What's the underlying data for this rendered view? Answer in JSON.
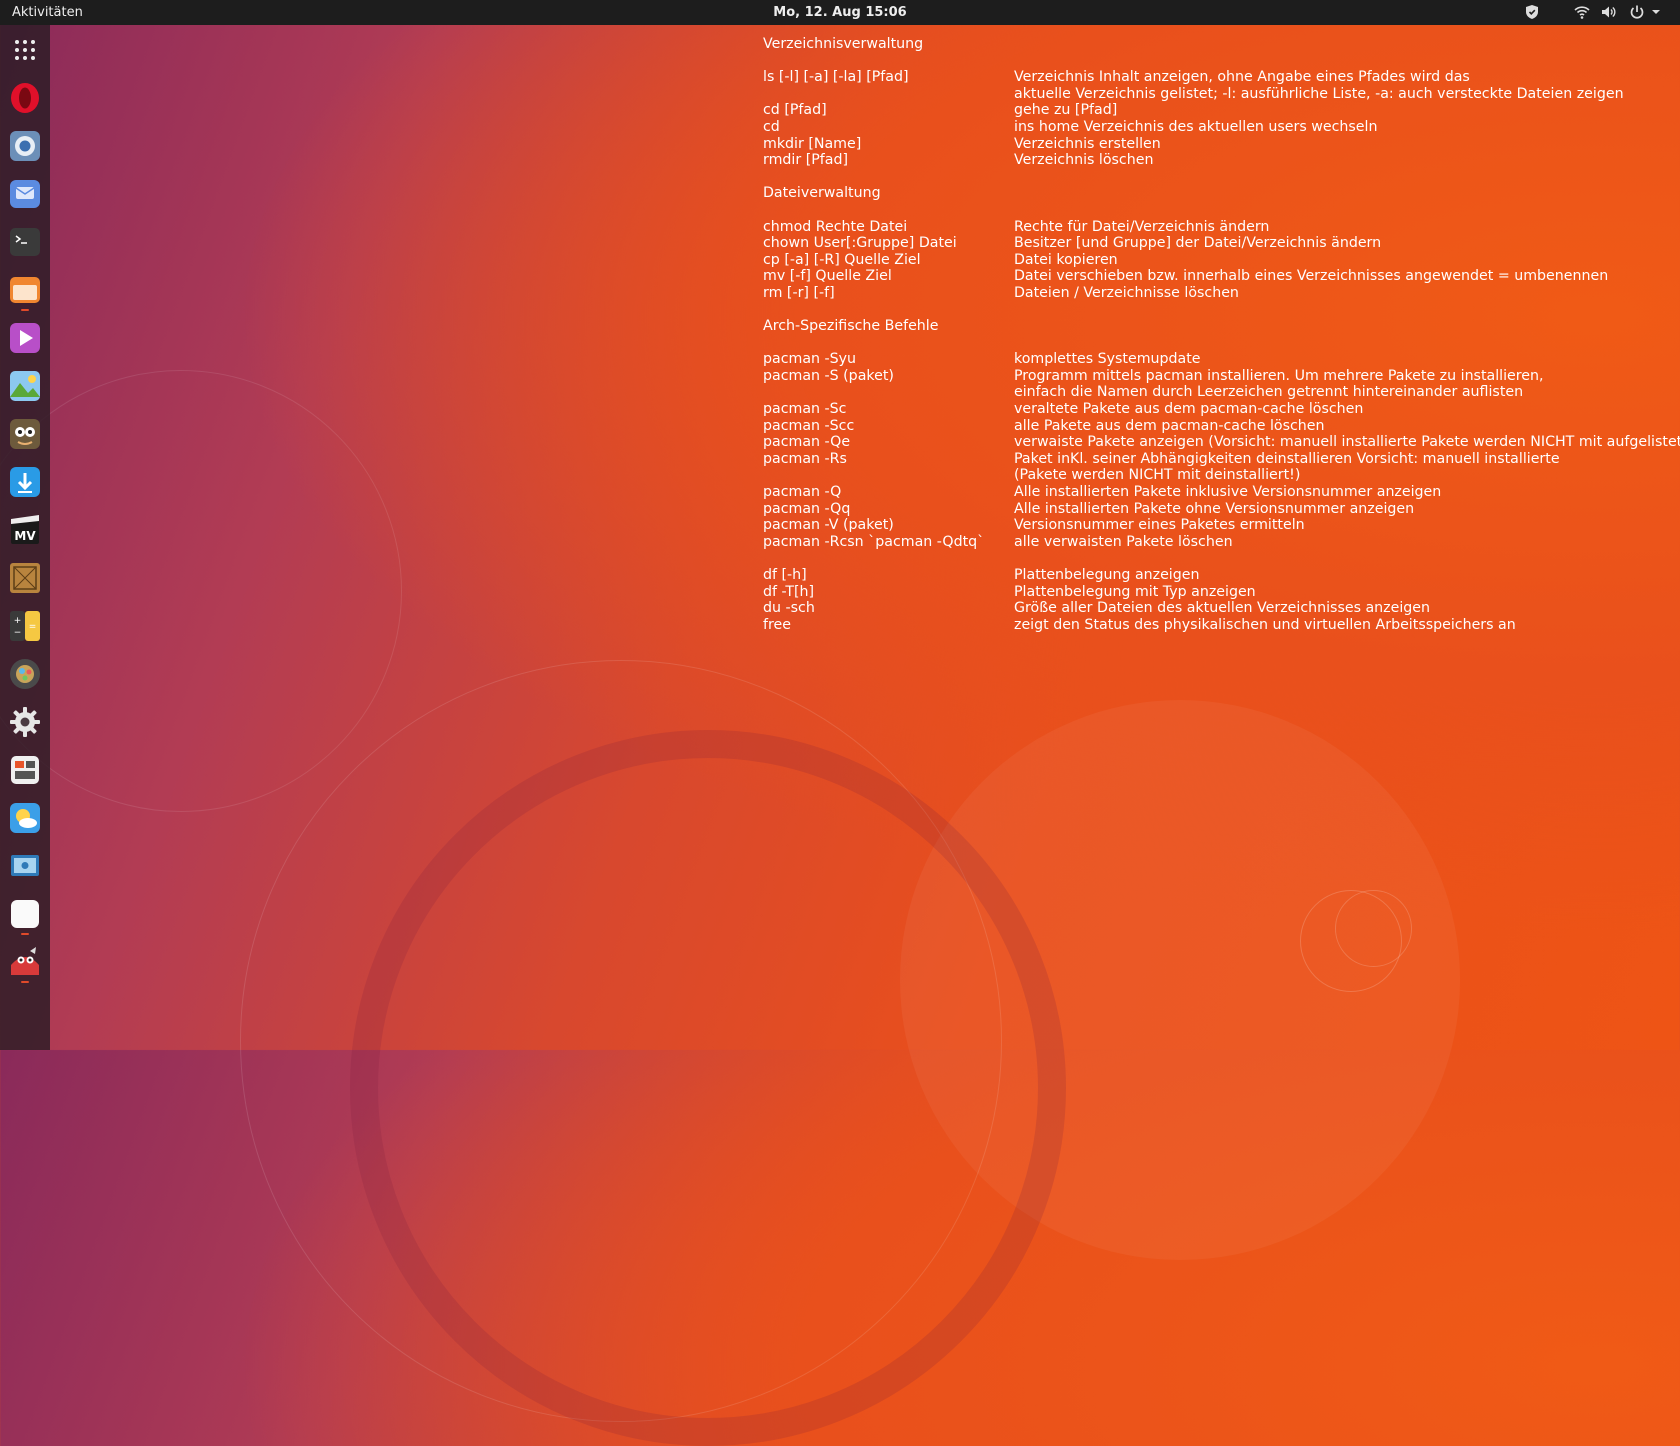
{
  "topbar": {
    "activities": "Aktivitäten",
    "clock": "Mo, 12. Aug  15:06",
    "tray_icons": [
      "shield-icon",
      "wifi-icon",
      "volume-icon",
      "power-icon",
      "chevron-down-icon"
    ]
  },
  "dock": {
    "items": [
      {
        "name": "app-grid-icon",
        "running": false
      },
      {
        "name": "opera-icon",
        "running": false
      },
      {
        "name": "chromium-icon",
        "running": false
      },
      {
        "name": "mail-icon",
        "running": false
      },
      {
        "name": "terminal-icon",
        "running": false
      },
      {
        "name": "files-icon",
        "running": true
      },
      {
        "name": "video-player-icon",
        "running": false
      },
      {
        "name": "image-viewer-icon",
        "running": false
      },
      {
        "name": "gimp-icon",
        "running": false
      },
      {
        "name": "download-icon",
        "running": false
      },
      {
        "name": "movie-editor-icon",
        "running": false
      },
      {
        "name": "dosbox-icon",
        "running": false
      },
      {
        "name": "calculator-icon",
        "running": false
      },
      {
        "name": "color-picker-icon",
        "running": false
      },
      {
        "name": "settings-icon",
        "running": false
      },
      {
        "name": "system-monitor-icon",
        "running": false
      },
      {
        "name": "weather-icon",
        "running": false
      },
      {
        "name": "screenshot-icon",
        "running": false
      },
      {
        "name": "text-editor-icon",
        "running": true
      },
      {
        "name": "gitkraken-icon",
        "running": true
      }
    ]
  },
  "notes": {
    "lines": [
      {
        "cmd": "Verzeichnisverwaltung",
        "desc": ""
      },
      {
        "cmd": "",
        "desc": ""
      },
      {
        "cmd": "ls [-l] [-a] [-la] [Pfad]",
        "desc": "Verzeichnis Inhalt anzeigen, ohne Angabe eines Pfades wird das"
      },
      {
        "cmd": "",
        "desc": "aktuelle Verzeichnis gelistet; -l: ausführliche Liste, -a: auch versteckte Dateien zeigen"
      },
      {
        "cmd": "cd [Pfad]",
        "desc": "gehe zu [Pfad]"
      },
      {
        "cmd": "cd",
        "desc": "ins home Verzeichnis des aktuellen users wechseln"
      },
      {
        "cmd": "mkdir [Name]",
        "desc": "Verzeichnis erstellen"
      },
      {
        "cmd": "rmdir [Pfad]",
        "desc": "Verzeichnis löschen"
      },
      {
        "cmd": "",
        "desc": ""
      },
      {
        "cmd": "Dateiverwaltung",
        "desc": ""
      },
      {
        "cmd": "",
        "desc": ""
      },
      {
        "cmd": "chmod Rechte Datei",
        "desc": "Rechte für Datei/Verzeichnis ändern"
      },
      {
        "cmd": "chown User[:Gruppe] Datei",
        "desc": "Besitzer [und Gruppe] der Datei/Verzeichnis ändern"
      },
      {
        "cmd": "cp [-a] [-R] Quelle Ziel",
        "desc": "Datei kopieren"
      },
      {
        "cmd": "mv [-f] Quelle Ziel",
        "desc": "Datei verschieben bzw. innerhalb eines Verzeichnisses angewendet = umbenennen"
      },
      {
        "cmd": "rm [-r] [-f]",
        "desc": "Dateien / Verzeichnisse löschen"
      },
      {
        "cmd": "",
        "desc": ""
      },
      {
        "cmd": "Arch-Spezifische Befehle",
        "desc": ""
      },
      {
        "cmd": "",
        "desc": ""
      },
      {
        "cmd": "pacman -Syu",
        "desc": "komplettes Systemupdate"
      },
      {
        "cmd": "pacman -S (paket)",
        "desc": "Programm mittels pacman installieren. Um mehrere Pakete zu installieren,"
      },
      {
        "cmd": "",
        "desc": "einfach die Namen durch Leerzeichen getrennt hintereinander auflisten"
      },
      {
        "cmd": "pacman -Sc",
        "desc": "veraltete Pakete aus dem pacman-cache löschen"
      },
      {
        "cmd": "pacman -Scc",
        "desc": "alle Pakete aus dem pacman-cache löschen"
      },
      {
        "cmd": "pacman -Qe",
        "desc": "verwaiste Pakete anzeigen (Vorsicht: manuell installierte Pakete werden NICHT mit aufgelistet"
      },
      {
        "cmd": "pacman -Rs",
        "desc": "Paket inKl. seiner Abhängigkeiten deinstallieren Vorsicht: manuell installierte"
      },
      {
        "cmd": "",
        "desc": "(Pakete werden NICHT mit deinstalliert!)"
      },
      {
        "cmd": "pacman -Q",
        "desc": "Alle installierten Pakete inklusive Versionsnummer anzeigen"
      },
      {
        "cmd": "pacman -Qq",
        "desc": "Alle installierten Pakete ohne Versionsnummer anzeigen"
      },
      {
        "cmd": "pacman -V (paket)",
        "desc": "Versionsnummer eines Paketes ermitteln"
      },
      {
        "cmd": "pacman -Rcsn `pacman -Qdtq`",
        "desc": "alle verwaisten Pakete löschen"
      },
      {
        "cmd": "",
        "desc": ""
      },
      {
        "cmd": "df [-h]",
        "desc": "Plattenbelegung anzeigen"
      },
      {
        "cmd": "df -T[h]",
        "desc": "Plattenbelegung mit Typ anzeigen"
      },
      {
        "cmd": "du -sch",
        "desc": "Größe aller Dateien des aktuellen Verzeichnisses anzeigen"
      },
      {
        "cmd": "free",
        "desc": "zeigt den Status des physikalischen und virtuellen Arbeitsspeichers an"
      }
    ]
  }
}
